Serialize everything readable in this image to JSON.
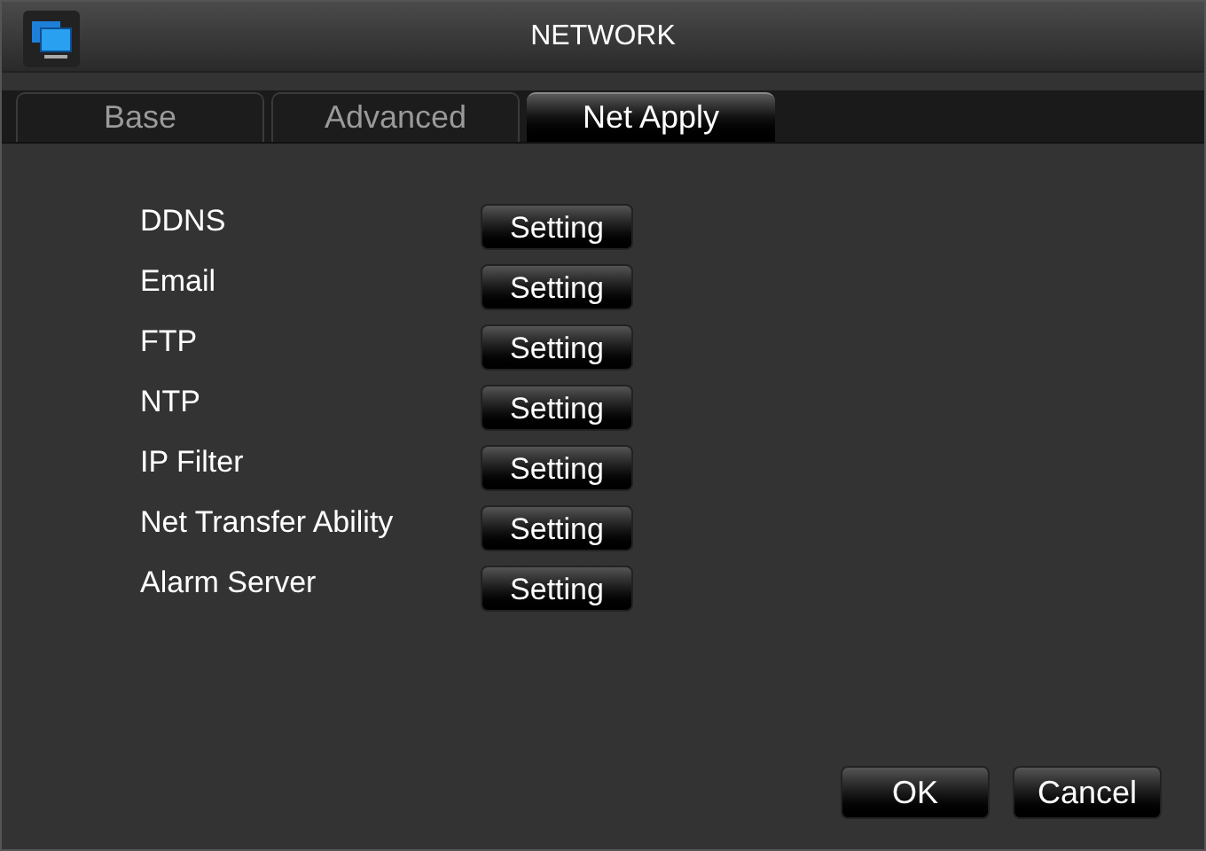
{
  "window": {
    "title": "NETWORK"
  },
  "tabs": [
    {
      "label": "Base",
      "selected": false
    },
    {
      "label": "Advanced",
      "selected": false
    },
    {
      "label": "Net Apply",
      "selected": true
    }
  ],
  "services": [
    {
      "label": "DDNS",
      "button": "Setting"
    },
    {
      "label": "Email",
      "button": "Setting"
    },
    {
      "label": "FTP",
      "button": "Setting"
    },
    {
      "label": "NTP",
      "button": "Setting"
    },
    {
      "label": "IP Filter",
      "button": "Setting"
    },
    {
      "label": "Net Transfer Ability",
      "button": "Setting"
    },
    {
      "label": "Alarm Server",
      "button": "Setting"
    }
  ],
  "buttons": [
    "OK",
    "Cancel"
  ]
}
